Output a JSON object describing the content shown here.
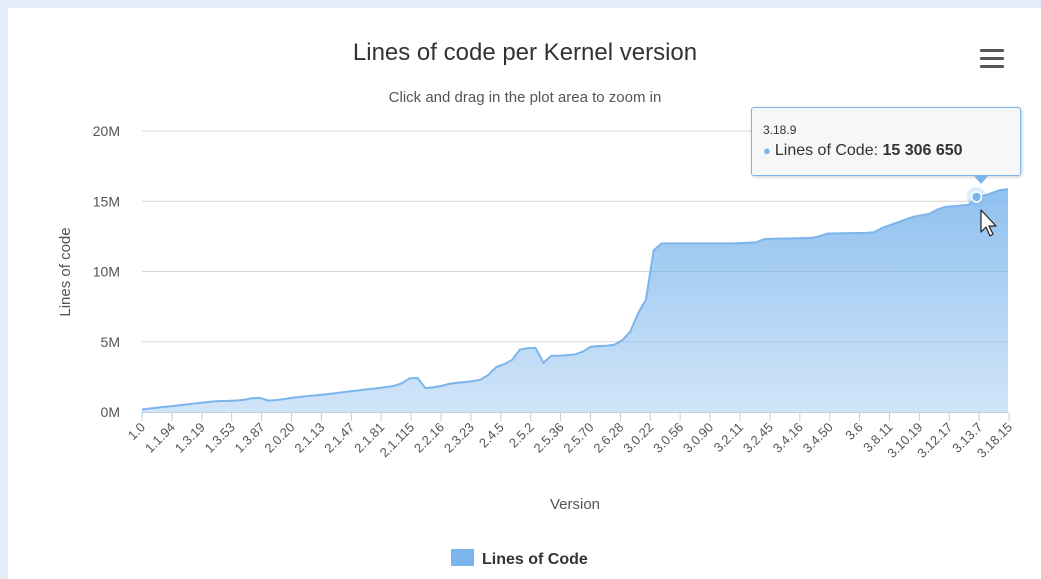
{
  "chart_data": {
    "type": "area",
    "title": "Lines of code per Kernel version",
    "subtitle": "Click and drag in the plot area to zoom in",
    "xlabel": "Version",
    "ylabel": "Lines of code",
    "ylim": [
      0,
      20000000
    ],
    "y_ticks": [
      "0M",
      "5M",
      "10M",
      "15M",
      "20M"
    ],
    "x_tick_labels": [
      "1.0",
      "1.1.94",
      "1.3.19",
      "1.3.53",
      "1.3.87",
      "2.0.20",
      "2.1.13",
      "2.1.47",
      "2.1.81",
      "2.1.115",
      "2.2.16",
      "2.3.23",
      "2.4.5",
      "2.5.2",
      "2.5.36",
      "2.5.70",
      "2.6.28",
      "3.0.22",
      "3.0.56",
      "3.0.90",
      "3.2.11",
      "3.2.45",
      "3.4.16",
      "3.4.50",
      "3.6",
      "3.8.11",
      "3.10.19",
      "3.12.17",
      "3.13.7",
      "3.18.15"
    ],
    "grid": true,
    "legend_position": "bottom-center",
    "series": [
      {
        "name": "Lines of Code",
        "color": "#7cb5ec",
        "values": [
          [
            0,
            180000
          ],
          [
            1,
            250000
          ],
          [
            2,
            310000
          ],
          [
            3,
            380000
          ],
          [
            4,
            430000
          ],
          [
            5,
            500000
          ],
          [
            6,
            560000
          ],
          [
            7,
            620000
          ],
          [
            8,
            680000
          ],
          [
            9,
            750000
          ],
          [
            10,
            780000
          ],
          [
            11,
            790000
          ],
          [
            12,
            820000
          ],
          [
            13,
            870000
          ],
          [
            14,
            980000
          ],
          [
            15,
            1000000
          ],
          [
            16,
            820000
          ],
          [
            17,
            850000
          ],
          [
            18,
            920000
          ],
          [
            19,
            1000000
          ],
          [
            20,
            1070000
          ],
          [
            21,
            1130000
          ],
          [
            22,
            1180000
          ],
          [
            23,
            1240000
          ],
          [
            24,
            1300000
          ],
          [
            25,
            1370000
          ],
          [
            26,
            1440000
          ],
          [
            27,
            1500000
          ],
          [
            28,
            1570000
          ],
          [
            29,
            1640000
          ],
          [
            30,
            1700000
          ],
          [
            31,
            1780000
          ],
          [
            32,
            1850000
          ],
          [
            33,
            2050000
          ],
          [
            34,
            2400000
          ],
          [
            35,
            2430000
          ],
          [
            36,
            1700000
          ],
          [
            37,
            1750000
          ],
          [
            38,
            1850000
          ],
          [
            39,
            2000000
          ],
          [
            40,
            2080000
          ],
          [
            41,
            2130000
          ],
          [
            42,
            2200000
          ],
          [
            43,
            2300000
          ],
          [
            44,
            2650000
          ],
          [
            45,
            3200000
          ],
          [
            46,
            3400000
          ],
          [
            47,
            3700000
          ],
          [
            48,
            4450000
          ],
          [
            49,
            4550000
          ],
          [
            50,
            4560000
          ],
          [
            51,
            3500000
          ],
          [
            52,
            4000000
          ],
          [
            53,
            4000000
          ],
          [
            54,
            4050000
          ],
          [
            55,
            4100000
          ],
          [
            56,
            4300000
          ],
          [
            57,
            4650000
          ],
          [
            58,
            4700000
          ],
          [
            59,
            4720000
          ],
          [
            60,
            4780000
          ],
          [
            61,
            5100000
          ],
          [
            62,
            5700000
          ],
          [
            63,
            7000000
          ],
          [
            64,
            8000000
          ],
          [
            65,
            11500000
          ],
          [
            66,
            12000000
          ],
          [
            67,
            12000000
          ],
          [
            68,
            12000000
          ],
          [
            69,
            12000000
          ],
          [
            70,
            12000000
          ],
          [
            71,
            12000000
          ],
          [
            72,
            12000000
          ],
          [
            73,
            12000000
          ],
          [
            74,
            12000000
          ],
          [
            75,
            12000000
          ],
          [
            76,
            12020000
          ],
          [
            77,
            12050000
          ],
          [
            78,
            12080000
          ],
          [
            79,
            12300000
          ],
          [
            80,
            12330000
          ],
          [
            81,
            12340000
          ],
          [
            82,
            12350000
          ],
          [
            83,
            12360000
          ],
          [
            84,
            12380000
          ],
          [
            85,
            12400000
          ],
          [
            86,
            12500000
          ],
          [
            87,
            12700000
          ],
          [
            88,
            12710000
          ],
          [
            89,
            12720000
          ],
          [
            90,
            12730000
          ],
          [
            91,
            12740000
          ],
          [
            92,
            12750000
          ],
          [
            93,
            12800000
          ],
          [
            94,
            13100000
          ],
          [
            95,
            13300000
          ],
          [
            96,
            13500000
          ],
          [
            97,
            13700000
          ],
          [
            98,
            13900000
          ],
          [
            99,
            14000000
          ],
          [
            100,
            14100000
          ],
          [
            101,
            14400000
          ],
          [
            102,
            14600000
          ],
          [
            103,
            14650000
          ],
          [
            104,
            14700000
          ],
          [
            105,
            14750000
          ],
          [
            106,
            15306650
          ],
          [
            107,
            15400000
          ],
          [
            108,
            15600000
          ],
          [
            109,
            15800000
          ],
          [
            110,
            15850000
          ]
        ]
      }
    ],
    "tooltip": {
      "version": "3.18.9",
      "series_label": "Lines of Code",
      "value_text": "15 306 650",
      "x_index": 106,
      "value": 15306650
    }
  }
}
